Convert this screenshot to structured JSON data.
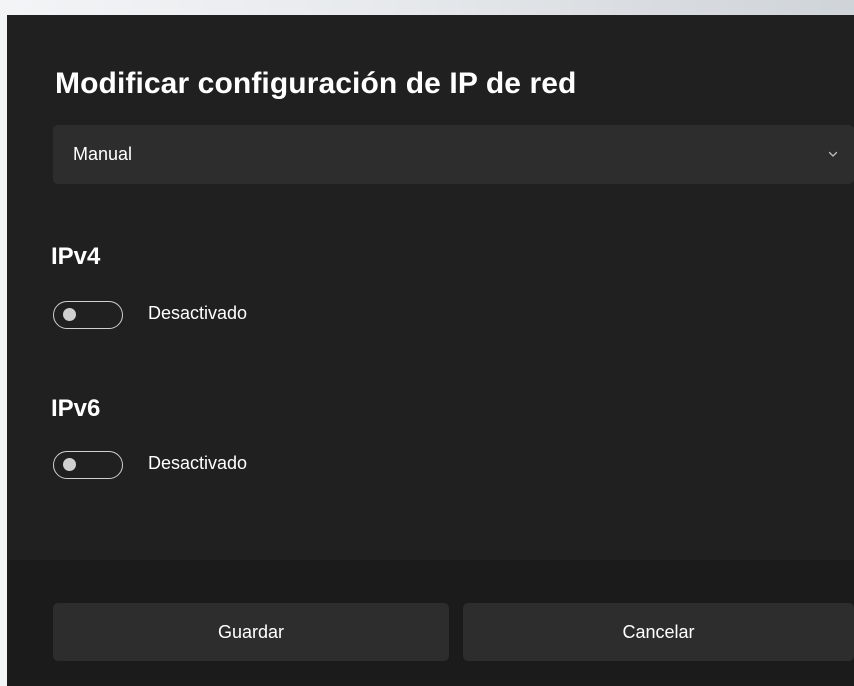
{
  "dialog": {
    "title": "Modificar configuración de IP de red"
  },
  "mode_dropdown": {
    "selected": "Manual",
    "icon": "chevron-down-icon"
  },
  "ipv4": {
    "heading": "IPv4",
    "toggle_state": "Desactivado",
    "enabled": false
  },
  "ipv6": {
    "heading": "IPv6",
    "toggle_state": "Desactivado",
    "enabled": false
  },
  "footer": {
    "save_label": "Guardar",
    "cancel_label": "Cancelar"
  },
  "colors": {
    "dialog_background": "#202020",
    "footer_background": "#1b1b1b",
    "control_background": "#2d2d2d",
    "text": "#ffffff"
  }
}
